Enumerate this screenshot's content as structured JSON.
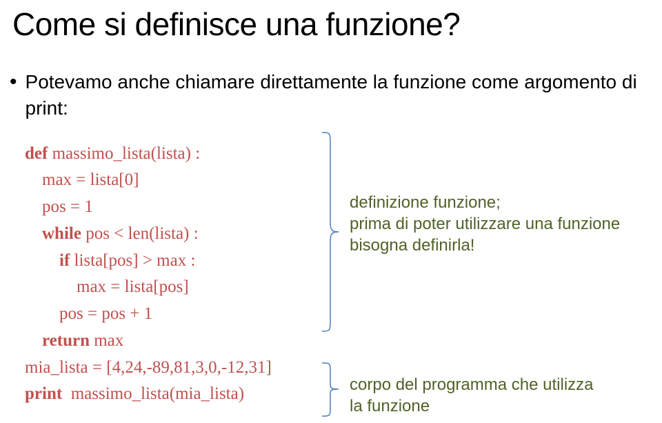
{
  "title": "Come si definisce una funzione?",
  "bullet_text": "Potevamo anche chiamare direttamente la funzione come argomento di print:",
  "code": {
    "l1a": "def",
    "l1b": " massimo_lista(lista) :",
    "l2": "    max = lista[0]",
    "l3": "    pos = 1",
    "l4a": "    ",
    "l4b": "while",
    "l4c": " pos < len(lista) :",
    "l5a": "        ",
    "l5b": "if",
    "l5c": " lista[pos] > max :",
    "l6": "            max = lista[pos]",
    "l7": "        pos = pos + 1",
    "l8a": "    ",
    "l8b": "return",
    "l8c": " max",
    "l9": "mia_lista = [4,24,-89,81,3,0,-12,31]",
    "l10a": "print",
    "l10b": "  massimo_lista(mia_lista)"
  },
  "annotation1_l1": "definizione funzione;",
  "annotation1_l2": "prima di poter utilizzare una funzione",
  "annotation1_l3": "bisogna definirla!",
  "annotation2_l1": "corpo del programma che utilizza",
  "annotation2_l2": "la funzione"
}
